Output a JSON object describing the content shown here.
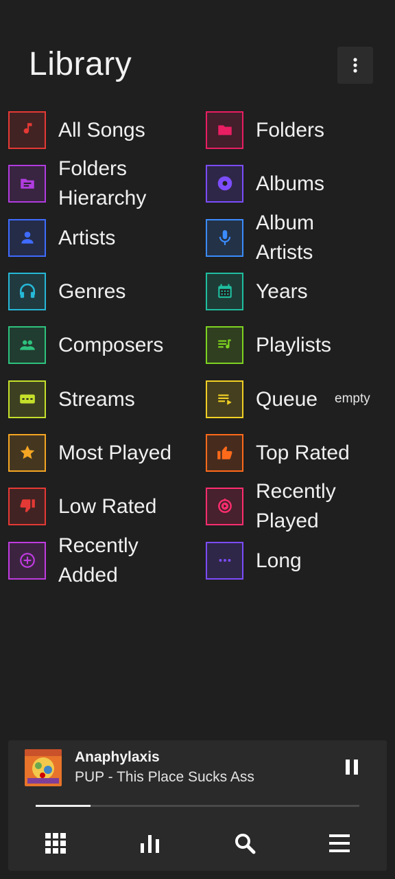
{
  "header": {
    "title": "Library",
    "menu_icon": "more-vert-icon"
  },
  "library": {
    "items": [
      {
        "label": "All Songs",
        "icon": "music-note-icon",
        "color": "#e53935"
      },
      {
        "label": "Folders",
        "icon": "folder-icon",
        "color": "#e91e63"
      },
      {
        "label": "Folders Hierarchy",
        "icon": "folder-tree-icon",
        "color": "#b13ce0"
      },
      {
        "label": "Albums",
        "icon": "album-icon",
        "color": "#7c4dff"
      },
      {
        "label": "Artists",
        "icon": "person-icon",
        "color": "#3f6bff"
      },
      {
        "label": "Album Artists",
        "icon": "mic-icon",
        "color": "#3b8cff"
      },
      {
        "label": "Genres",
        "icon": "headphones-icon",
        "color": "#26b8d8"
      },
      {
        "label": "Years",
        "icon": "calendar-icon",
        "color": "#1fbfa0"
      },
      {
        "label": "Composers",
        "icon": "group-icon",
        "color": "#2ec27e"
      },
      {
        "label": "Playlists",
        "icon": "playlist-icon",
        "color": "#7ed321"
      },
      {
        "label": "Streams",
        "icon": "stream-icon",
        "color": "#c6e02b"
      },
      {
        "label": "Queue",
        "icon": "queue-icon",
        "color": "#f2d024",
        "sub": "empty"
      },
      {
        "label": "Most Played",
        "icon": "star-icon",
        "color": "#f5a623"
      },
      {
        "label": "Top Rated",
        "icon": "thumb-up-icon",
        "color": "#ff6a1a"
      },
      {
        "label": "Low Rated",
        "icon": "thumb-down-icon",
        "color": "#e53935"
      },
      {
        "label": "Recently Played",
        "icon": "recent-play-icon",
        "color": "#ff2d6f"
      },
      {
        "label": "Recently Added",
        "icon": "add-circle-icon",
        "color": "#c03be0"
      },
      {
        "label": "Long",
        "icon": "more-horiz-icon",
        "color": "#7c4dff"
      }
    ]
  },
  "player": {
    "title": "Anaphylaxis",
    "artist": "PUP - This Place Sucks Ass",
    "progress": 0.17,
    "pause_icon": "pause-icon"
  },
  "nav": {
    "icons": [
      "grid-icon",
      "equalizer-icon",
      "search-icon",
      "menu-icon"
    ]
  }
}
